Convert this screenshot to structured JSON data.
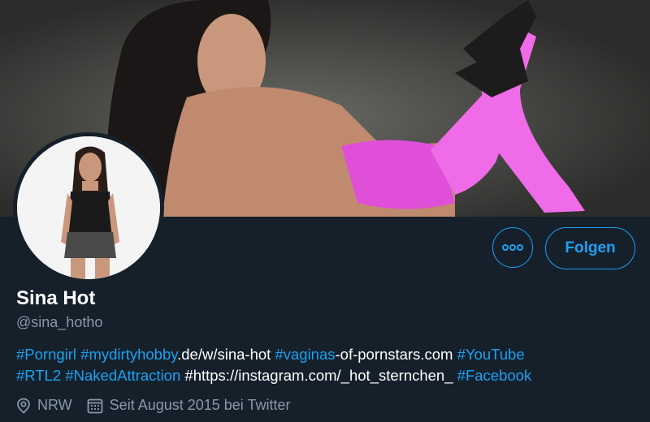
{
  "colors": {
    "background": "#15202b",
    "accent": "#1da1f2",
    "secondary_text": "#8899a6",
    "primary_text": "#ffffff"
  },
  "profile": {
    "name": "Sina Hot",
    "handle": "@sina_hotho",
    "more_icon": "more-dots-icon",
    "follow_label": "Folgen"
  },
  "bio": {
    "line1": {
      "t1": "#Porngirl",
      "t2": "#mydirtyhobby",
      "p2": ".de/w/sina-hot",
      "t3": "#vaginas",
      "p3": "-of-pornstars.com",
      "t4": "#YouTube"
    },
    "line2": {
      "t1": "#RTL2",
      "t2": "#NakedAttraction",
      "p1": "#https://instagram.com/_hot_sternchen_",
      "t3": "#Facebook"
    }
  },
  "meta": {
    "location_icon": "location-pin-icon",
    "location": "NRW",
    "calendar_icon": "calendar-icon",
    "joined": "Seit August 2015 bei Twitter"
  }
}
